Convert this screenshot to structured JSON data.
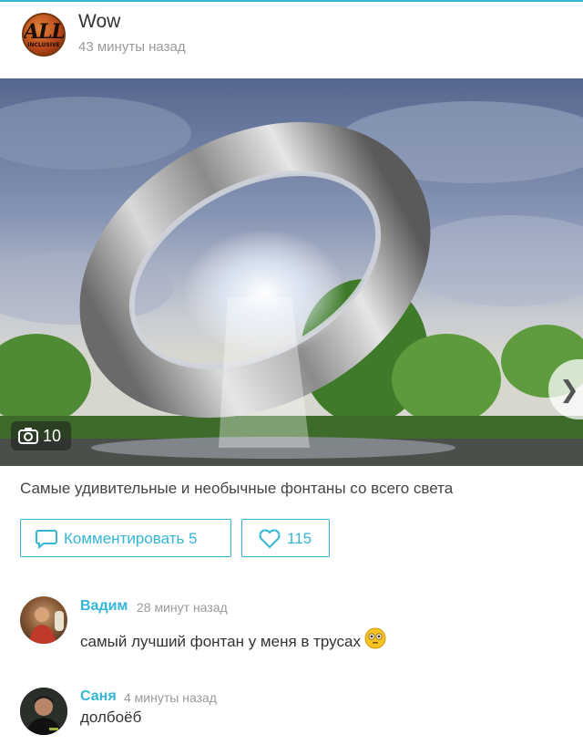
{
  "post": {
    "group_name": "Wow",
    "time": "43 минуты назад",
    "avatar_logo": "ALL",
    "avatar_sub": "INCLUSIVE",
    "photo_count": "10",
    "caption": "Самые удивительные и необычные фонтаны со всего света"
  },
  "actions": {
    "comment_label": "Комментировать 5",
    "likes": "115"
  },
  "comments": [
    {
      "author": "Вадим",
      "time": "28 минут назад",
      "text": "самый лучший фонтан у меня в трусах"
    },
    {
      "author": "Саня",
      "time": "4 минуты назад",
      "text": "долбоёб"
    }
  ],
  "colors": {
    "accent": "#35b6d6",
    "muted": "#9a9a9a"
  },
  "icons": [
    "camera-icon",
    "chevron-right-icon",
    "comment-icon",
    "heart-icon",
    "flushed-emoji-icon"
  ]
}
